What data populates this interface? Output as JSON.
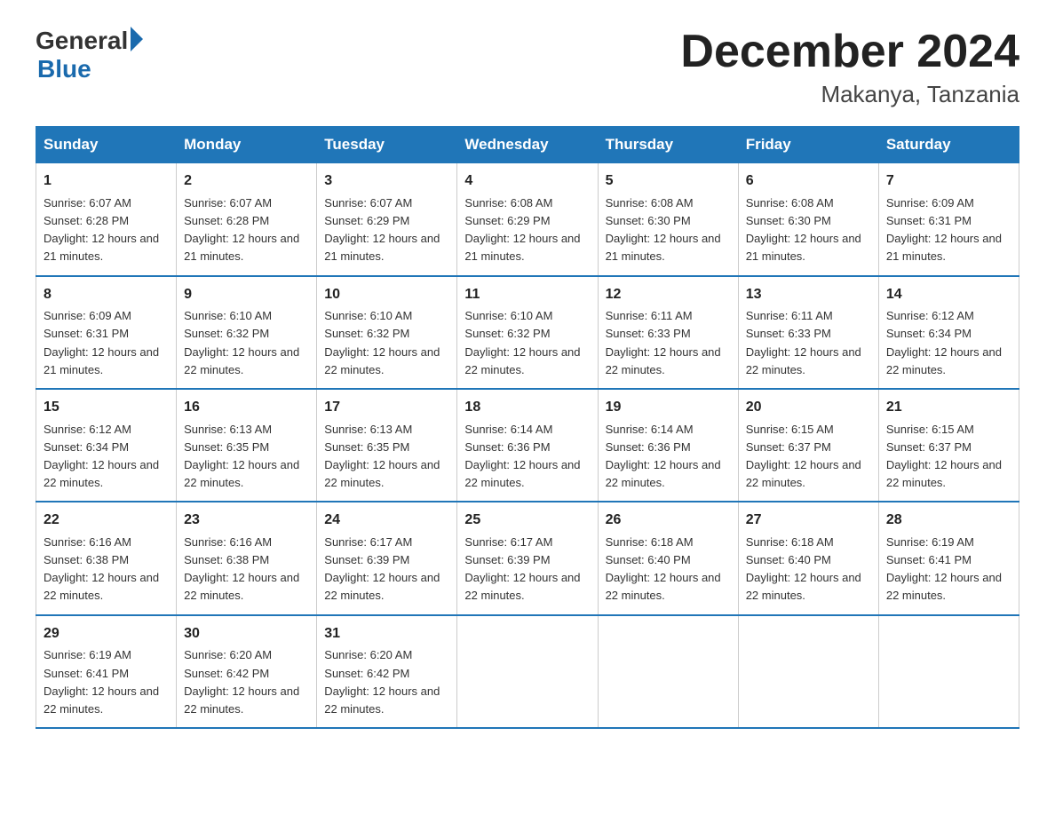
{
  "header": {
    "logo_general": "General",
    "logo_blue": "Blue",
    "title": "December 2024",
    "subtitle": "Makanya, Tanzania"
  },
  "days_of_week": [
    "Sunday",
    "Monday",
    "Tuesday",
    "Wednesday",
    "Thursday",
    "Friday",
    "Saturday"
  ],
  "weeks": [
    [
      {
        "day": "1",
        "sunrise": "6:07 AM",
        "sunset": "6:28 PM",
        "daylight": "12 hours and 21 minutes."
      },
      {
        "day": "2",
        "sunrise": "6:07 AM",
        "sunset": "6:28 PM",
        "daylight": "12 hours and 21 minutes."
      },
      {
        "day": "3",
        "sunrise": "6:07 AM",
        "sunset": "6:29 PM",
        "daylight": "12 hours and 21 minutes."
      },
      {
        "day": "4",
        "sunrise": "6:08 AM",
        "sunset": "6:29 PM",
        "daylight": "12 hours and 21 minutes."
      },
      {
        "day": "5",
        "sunrise": "6:08 AM",
        "sunset": "6:30 PM",
        "daylight": "12 hours and 21 minutes."
      },
      {
        "day": "6",
        "sunrise": "6:08 AM",
        "sunset": "6:30 PM",
        "daylight": "12 hours and 21 minutes."
      },
      {
        "day": "7",
        "sunrise": "6:09 AM",
        "sunset": "6:31 PM",
        "daylight": "12 hours and 21 minutes."
      }
    ],
    [
      {
        "day": "8",
        "sunrise": "6:09 AM",
        "sunset": "6:31 PM",
        "daylight": "12 hours and 21 minutes."
      },
      {
        "day": "9",
        "sunrise": "6:10 AM",
        "sunset": "6:32 PM",
        "daylight": "12 hours and 22 minutes."
      },
      {
        "day": "10",
        "sunrise": "6:10 AM",
        "sunset": "6:32 PM",
        "daylight": "12 hours and 22 minutes."
      },
      {
        "day": "11",
        "sunrise": "6:10 AM",
        "sunset": "6:32 PM",
        "daylight": "12 hours and 22 minutes."
      },
      {
        "day": "12",
        "sunrise": "6:11 AM",
        "sunset": "6:33 PM",
        "daylight": "12 hours and 22 minutes."
      },
      {
        "day": "13",
        "sunrise": "6:11 AM",
        "sunset": "6:33 PM",
        "daylight": "12 hours and 22 minutes."
      },
      {
        "day": "14",
        "sunrise": "6:12 AM",
        "sunset": "6:34 PM",
        "daylight": "12 hours and 22 minutes."
      }
    ],
    [
      {
        "day": "15",
        "sunrise": "6:12 AM",
        "sunset": "6:34 PM",
        "daylight": "12 hours and 22 minutes."
      },
      {
        "day": "16",
        "sunrise": "6:13 AM",
        "sunset": "6:35 PM",
        "daylight": "12 hours and 22 minutes."
      },
      {
        "day": "17",
        "sunrise": "6:13 AM",
        "sunset": "6:35 PM",
        "daylight": "12 hours and 22 minutes."
      },
      {
        "day": "18",
        "sunrise": "6:14 AM",
        "sunset": "6:36 PM",
        "daylight": "12 hours and 22 minutes."
      },
      {
        "day": "19",
        "sunrise": "6:14 AM",
        "sunset": "6:36 PM",
        "daylight": "12 hours and 22 minutes."
      },
      {
        "day": "20",
        "sunrise": "6:15 AM",
        "sunset": "6:37 PM",
        "daylight": "12 hours and 22 minutes."
      },
      {
        "day": "21",
        "sunrise": "6:15 AM",
        "sunset": "6:37 PM",
        "daylight": "12 hours and 22 minutes."
      }
    ],
    [
      {
        "day": "22",
        "sunrise": "6:16 AM",
        "sunset": "6:38 PM",
        "daylight": "12 hours and 22 minutes."
      },
      {
        "day": "23",
        "sunrise": "6:16 AM",
        "sunset": "6:38 PM",
        "daylight": "12 hours and 22 minutes."
      },
      {
        "day": "24",
        "sunrise": "6:17 AM",
        "sunset": "6:39 PM",
        "daylight": "12 hours and 22 minutes."
      },
      {
        "day": "25",
        "sunrise": "6:17 AM",
        "sunset": "6:39 PM",
        "daylight": "12 hours and 22 minutes."
      },
      {
        "day": "26",
        "sunrise": "6:18 AM",
        "sunset": "6:40 PM",
        "daylight": "12 hours and 22 minutes."
      },
      {
        "day": "27",
        "sunrise": "6:18 AM",
        "sunset": "6:40 PM",
        "daylight": "12 hours and 22 minutes."
      },
      {
        "day": "28",
        "sunrise": "6:19 AM",
        "sunset": "6:41 PM",
        "daylight": "12 hours and 22 minutes."
      }
    ],
    [
      {
        "day": "29",
        "sunrise": "6:19 AM",
        "sunset": "6:41 PM",
        "daylight": "12 hours and 22 minutes."
      },
      {
        "day": "30",
        "sunrise": "6:20 AM",
        "sunset": "6:42 PM",
        "daylight": "12 hours and 22 minutes."
      },
      {
        "day": "31",
        "sunrise": "6:20 AM",
        "sunset": "6:42 PM",
        "daylight": "12 hours and 22 minutes."
      },
      {
        "day": "",
        "sunrise": "",
        "sunset": "",
        "daylight": ""
      },
      {
        "day": "",
        "sunrise": "",
        "sunset": "",
        "daylight": ""
      },
      {
        "day": "",
        "sunrise": "",
        "sunset": "",
        "daylight": ""
      },
      {
        "day": "",
        "sunrise": "",
        "sunset": "",
        "daylight": ""
      }
    ]
  ],
  "labels": {
    "sunrise": "Sunrise:",
    "sunset": "Sunset:",
    "daylight": "Daylight:"
  },
  "colors": {
    "header_bg": "#2076b8",
    "border_accent": "#2076b8"
  }
}
